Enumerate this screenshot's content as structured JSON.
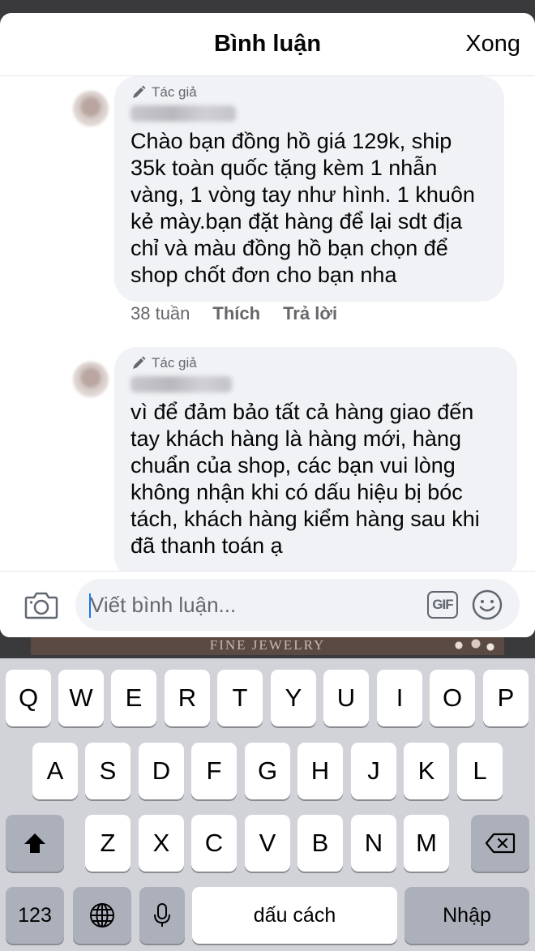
{
  "header": {
    "title": "Bình luận",
    "done_label": "Xong"
  },
  "comments": [
    {
      "author_badge": "Tác giả",
      "text": "Chào bạn đồng hồ giá 129k, ship\n35k toàn quốc tặng kèm 1 nhẫn\nvàng, 1 vòng tay như hình. 1 khuôn\nkẻ mày.bạn đặt hàng để lại sdt địa\nchỉ và màu đồng hồ bạn chọn để\nshop chốt đơn cho bạn nha",
      "time": "38 tuần",
      "like_label": "Thích",
      "reply_label": "Trả lời"
    },
    {
      "author_badge": "Tác giả",
      "text": "vì để đảm bảo tất cả hàng giao đến\ntay khách hàng là hàng mới, hàng\nchuẩn của shop, các bạn vui lòng\nkhông nhận khi có dấu hiệu bị bóc\ntách, khách hàng kiểm hàng sau khi\nđã thanh toán ạ"
    }
  ],
  "composer": {
    "placeholder": "Viết bình luận...",
    "gif_label": "GIF"
  },
  "backdrop": {
    "banner_text": "FINE JEWELRY"
  },
  "keyboard": {
    "row1": [
      "Q",
      "W",
      "E",
      "R",
      "T",
      "Y",
      "U",
      "I",
      "O",
      "P"
    ],
    "row2": [
      "A",
      "S",
      "D",
      "F",
      "G",
      "H",
      "J",
      "K",
      "L"
    ],
    "row3": [
      "Z",
      "X",
      "C",
      "V",
      "B",
      "N",
      "M"
    ],
    "numbers_label": "123",
    "space_label": "dấu cách",
    "return_label": "Nhập"
  }
}
